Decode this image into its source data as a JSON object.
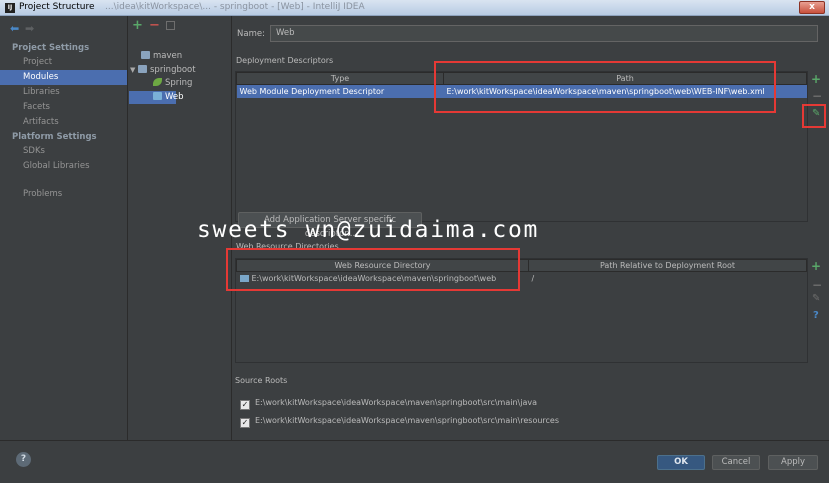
{
  "window": {
    "title": "Project Structure",
    "faded_title": "...\\idea\\kitWorkspace\\... - springboot - [Web] - IntelliJ IDEA",
    "close_label": "x"
  },
  "nav": {
    "section_project": "Project Settings",
    "project_items": [
      "Project",
      "Modules",
      "Libraries",
      "Facets",
      "Artifacts"
    ],
    "section_platform": "Platform Settings",
    "platform_items": [
      "SDKs",
      "Global Libraries"
    ],
    "problems": "Problems"
  },
  "tree": {
    "nodes": [
      {
        "label": "maven",
        "icon": "folder-icon"
      },
      {
        "label": "springboot",
        "icon": "folder-icon"
      },
      {
        "label": "Spring",
        "icon": "spring-leaf-icon"
      },
      {
        "label": "Web",
        "icon": "web-facet-icon"
      }
    ]
  },
  "main": {
    "name_label": "Name:",
    "name_value": "Web",
    "descriptors_title": "Deployment Descriptors",
    "descriptors_columns": [
      "Type",
      "Path"
    ],
    "descriptors_rows": [
      {
        "type": "Web Module Deployment Descriptor",
        "path": "E:\\work\\kitWorkspace\\ideaWorkspace\\maven\\springboot\\web\\WEB-INF\\web.xml"
      }
    ],
    "add_server_button": "Add Application Server specific descriptor...",
    "resources_title": "Web Resource Directories",
    "resources_columns": [
      "Web Resource Directory",
      "Path Relative to Deployment Root"
    ],
    "resources_rows": [
      {
        "dir": "E:\\work\\kitWorkspace\\ideaWorkspace\\maven\\springboot\\web",
        "rel": "/"
      }
    ],
    "source_roots_title": "Source Roots",
    "source_roots": [
      "E:\\work\\kitWorkspace\\ideaWorkspace\\maven\\springboot\\src\\main\\java",
      "E:\\work\\kitWorkspace\\ideaWorkspace\\maven\\springboot\\src\\main\\resources"
    ],
    "watermark": "sweets wn@zuidaima.com"
  },
  "buttons": {
    "help": "?",
    "ok": "OK",
    "cancel": "Cancel",
    "apply": "Apply"
  },
  "colors": {
    "selection": "#4b6eaf",
    "highlight_box": "#e53935",
    "add": "#59a869",
    "remove": "#c75450"
  }
}
